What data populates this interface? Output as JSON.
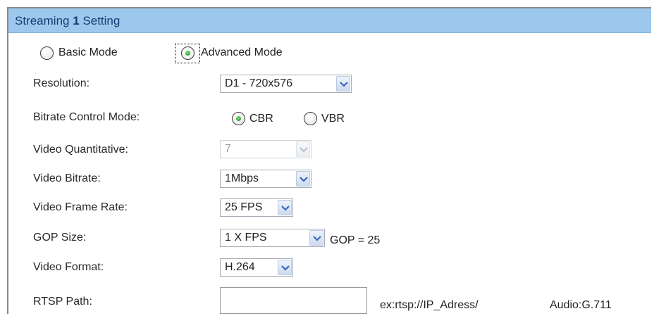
{
  "header": {
    "title_prefix": "Streaming ",
    "stream_number": "1",
    "title_suffix": " Setting"
  },
  "mode": {
    "basic_label": "Basic Mode",
    "advanced_label": "Advanced Mode",
    "selected": "advanced"
  },
  "fields": {
    "resolution": {
      "label": "Resolution:",
      "value": "D1 - 720x576"
    },
    "bitrate_control": {
      "label": "Bitrate Control Mode:",
      "cbr_label": "CBR",
      "vbr_label": "VBR",
      "selected": "CBR"
    },
    "quantitative": {
      "label": "Video Quantitative:",
      "value": "7",
      "disabled": true
    },
    "bitrate": {
      "label": "Video Bitrate:",
      "value": "1Mbps"
    },
    "frame_rate": {
      "label": "Video Frame Rate:",
      "value": "25 FPS"
    },
    "gop": {
      "label": "GOP Size:",
      "value": "1 X FPS",
      "note": "GOP = 25"
    },
    "format": {
      "label": "Video Format:",
      "value": "H.264"
    },
    "rtsp": {
      "label": "RTSP Path:",
      "value": "",
      "example": "ex:rtsp://IP_Adress/",
      "audio": "Audio:G.711"
    }
  },
  "colors": {
    "header_bg": "#9cc8ee",
    "header_text": "#173d74",
    "radio_dot": "#2aa52a"
  }
}
